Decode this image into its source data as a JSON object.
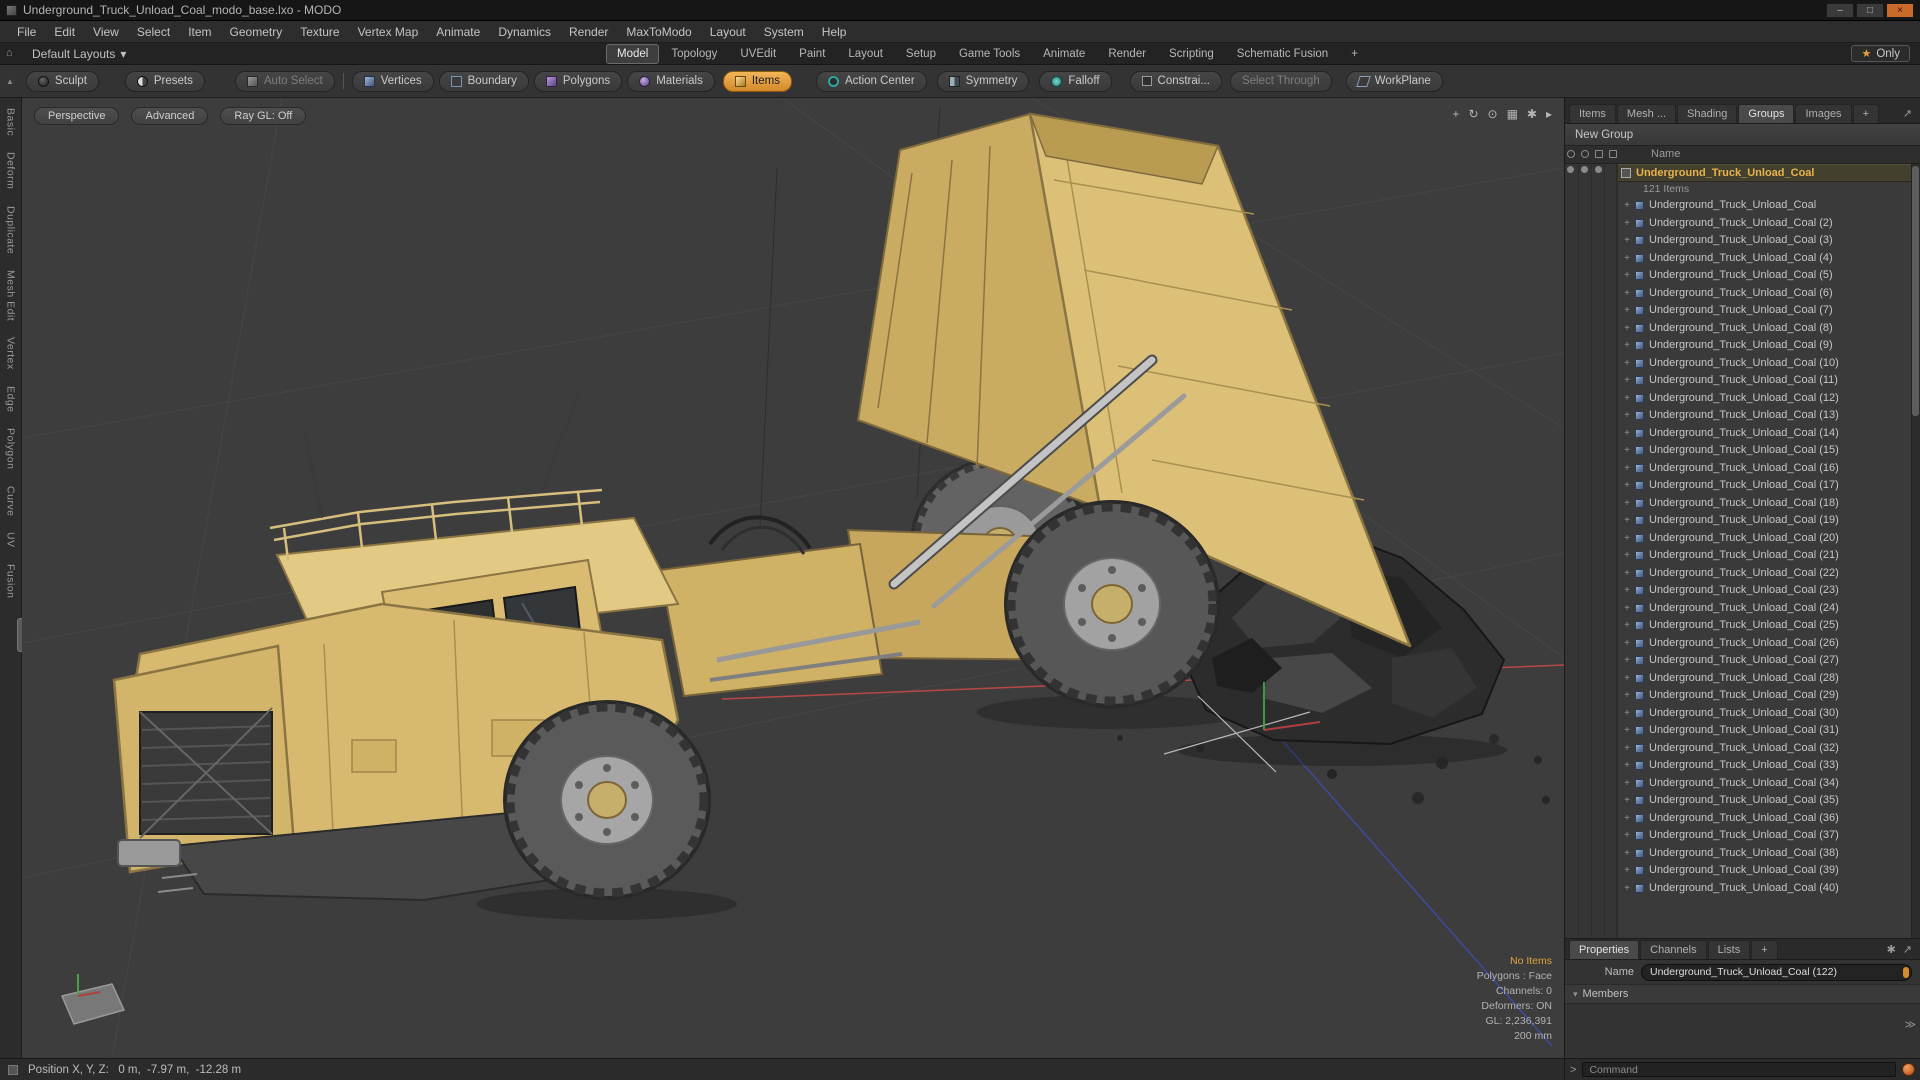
{
  "window": {
    "title": "Underground_Truck_Unload_Coal_modo_base.lxo - MODO",
    "controls": {
      "minimize": "–",
      "maximize": "□",
      "close": "×"
    }
  },
  "menubar": {
    "items": [
      "File",
      "Edit",
      "View",
      "Select",
      "Item",
      "Geometry",
      "Texture",
      "Vertex Map",
      "Animate",
      "Dynamics",
      "Render",
      "MaxToModo",
      "Layout",
      "System",
      "Help"
    ]
  },
  "layout_bar": {
    "home_icon": "⌂",
    "default_layouts": "Default Layouts",
    "caret": "▾",
    "star_icon": "★",
    "only_label": "Only",
    "tabs": [
      {
        "label": "Model",
        "active": true
      },
      {
        "label": "Topology"
      },
      {
        "label": "UVEdit"
      },
      {
        "label": "Paint"
      },
      {
        "label": "Layout"
      },
      {
        "label": "Setup"
      },
      {
        "label": "Game Tools"
      },
      {
        "label": "Animate"
      },
      {
        "label": "Render"
      },
      {
        "label": "Scripting"
      },
      {
        "label": "Schematic Fusion"
      },
      {
        "label": "+"
      }
    ]
  },
  "toolbar": {
    "collapse_glyph": "▲",
    "sculpt": "Sculpt",
    "presets": "Presets",
    "auto_select": "Auto Select",
    "vertices": "Vertices",
    "boundary": "Boundary",
    "polygons": "Polygons",
    "materials": "Materials",
    "items": "Items",
    "action_center": "Action Center",
    "symmetry": "Symmetry",
    "falloff": "Falloff",
    "constraints": "Constrai...",
    "select_through": "Select Through",
    "workplane": "WorkPlane"
  },
  "left_tabs": [
    "Basic",
    "Deform",
    "Duplicate",
    "Mesh Edit",
    "Vertex",
    "Edge",
    "Polygon",
    "Curve",
    "UV",
    "Fusion"
  ],
  "viewport": {
    "buttons": [
      "Perspective",
      "Advanced",
      "Ray GL: Off"
    ],
    "icons": {
      "pan": "+",
      "orbit": "↻",
      "zoom": "⊙",
      "grid": "▦",
      "settings": "✱",
      "more": "▸"
    },
    "info": {
      "no_items": "No Items",
      "polygons": "Polygons : Face",
      "channels": "Channels: 0",
      "deformers": "Deformers: ON",
      "gl": "GL: 2,236,391",
      "scale": "200 mm"
    }
  },
  "right_panel": {
    "tabs": [
      {
        "label": "Items"
      },
      {
        "label": "Mesh ..."
      },
      {
        "label": "Shading"
      },
      {
        "label": "Groups",
        "active": true
      },
      {
        "label": "Images"
      },
      {
        "label": "+"
      }
    ],
    "expand_glyph": "↗",
    "new_group": "New Group",
    "name_header": "Name",
    "expander_glyph": "+",
    "group": {
      "label": "Underground_Truck_Unload_Coal",
      "count": "121 Items"
    },
    "items": [
      "Underground_Truck_Unload_Coal",
      "Underground_Truck_Unload_Coal (2)",
      "Underground_Truck_Unload_Coal (3)",
      "Underground_Truck_Unload_Coal (4)",
      "Underground_Truck_Unload_Coal (5)",
      "Underground_Truck_Unload_Coal (6)",
      "Underground_Truck_Unload_Coal (7)",
      "Underground_Truck_Unload_Coal (8)",
      "Underground_Truck_Unload_Coal (9)",
      "Underground_Truck_Unload_Coal (10)",
      "Underground_Truck_Unload_Coal (11)",
      "Underground_Truck_Unload_Coal (12)",
      "Underground_Truck_Unload_Coal (13)",
      "Underground_Truck_Unload_Coal (14)",
      "Underground_Truck_Unload_Coal (15)",
      "Underground_Truck_Unload_Coal (16)",
      "Underground_Truck_Unload_Coal (17)",
      "Underground_Truck_Unload_Coal (18)",
      "Underground_Truck_Unload_Coal (19)",
      "Underground_Truck_Unload_Coal (20)",
      "Underground_Truck_Unload_Coal (21)",
      "Underground_Truck_Unload_Coal (22)",
      "Underground_Truck_Unload_Coal (23)",
      "Underground_Truck_Unload_Coal (24)",
      "Underground_Truck_Unload_Coal (25)",
      "Underground_Truck_Unload_Coal (26)",
      "Underground_Truck_Unload_Coal (27)",
      "Underground_Truck_Unload_Coal (28)",
      "Underground_Truck_Unload_Coal (29)",
      "Underground_Truck_Unload_Coal (30)",
      "Underground_Truck_Unload_Coal (31)",
      "Underground_Truck_Unload_Coal (32)",
      "Underground_Truck_Unload_Coal (33)",
      "Underground_Truck_Unload_Coal (34)",
      "Underground_Truck_Unload_Coal (35)",
      "Underground_Truck_Unload_Coal (36)",
      "Underground_Truck_Unload_Coal (37)",
      "Underground_Truck_Unload_Coal (38)",
      "Underground_Truck_Unload_Coal (39)",
      "Underground_Truck_Unload_Coal (40)"
    ]
  },
  "properties": {
    "tabs": [
      {
        "label": "Properties",
        "active": true
      },
      {
        "label": "Channels"
      },
      {
        "label": "Lists"
      },
      {
        "label": "+"
      }
    ],
    "icons": {
      "gear": "✱",
      "expand": "↗"
    },
    "name_label": "Name",
    "name_value": "Underground_Truck_Unload_Coal (122)",
    "members_caret": "▾",
    "members_label": "Members",
    "more_glyph": "≫",
    "command_prompt": ">",
    "command_placeholder": "Command"
  },
  "statusbar": {
    "position": "Position X, Y, Z:   0 m,  -7.97 m,  -12.28 m"
  }
}
